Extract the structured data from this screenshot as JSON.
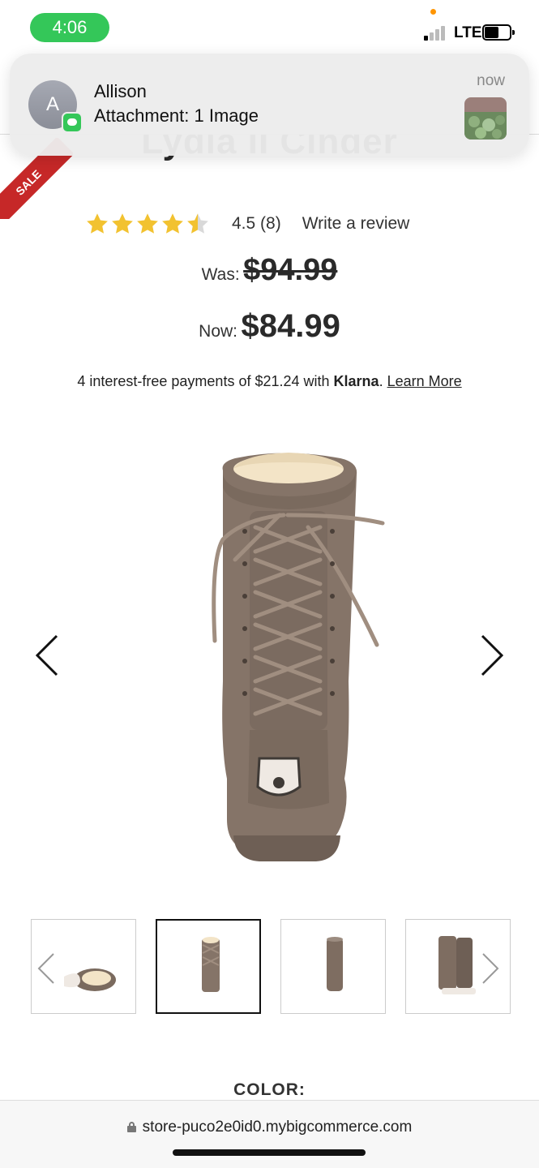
{
  "status_bar": {
    "time": "4:06",
    "network": "LTE",
    "colors": {
      "time_pill": "#34c759",
      "mic_dot": "#ff9500"
    }
  },
  "notification": {
    "avatar_initial": "A",
    "sender": "Allison",
    "message": "Attachment: 1 Image",
    "time": "now",
    "app_icon": "messages-icon"
  },
  "product": {
    "title_fragment": "Lydia II Cinder",
    "sale_badge": "SALE",
    "rating": {
      "value": 4.5,
      "text": "4.5 (8)",
      "stars_max": 5
    },
    "write_review_label": "Write a review",
    "was_label": "Was:",
    "was_price": "$94.99",
    "now_label": "Now:",
    "now_price": "$84.99",
    "klarna": {
      "text_before": "4 interest-free payments of $21.24 with ",
      "brand": "Klarna",
      "text_after": ". ",
      "link": "Learn More"
    },
    "thumbnails": [
      {
        "name": "thumb-boot-top-view",
        "selected": false
      },
      {
        "name": "thumb-boot-back-view",
        "selected": true
      },
      {
        "name": "thumb-boot-side-view",
        "selected": false
      },
      {
        "name": "thumb-boot-pair-view",
        "selected": false
      }
    ],
    "color_label": "COLOR:",
    "colors": {
      "sale_ribbon": "#c62828",
      "star": "#f2c230",
      "boot": "#857468"
    }
  },
  "browser": {
    "url": "store-puco2e0id0.mybigcommerce.com"
  }
}
